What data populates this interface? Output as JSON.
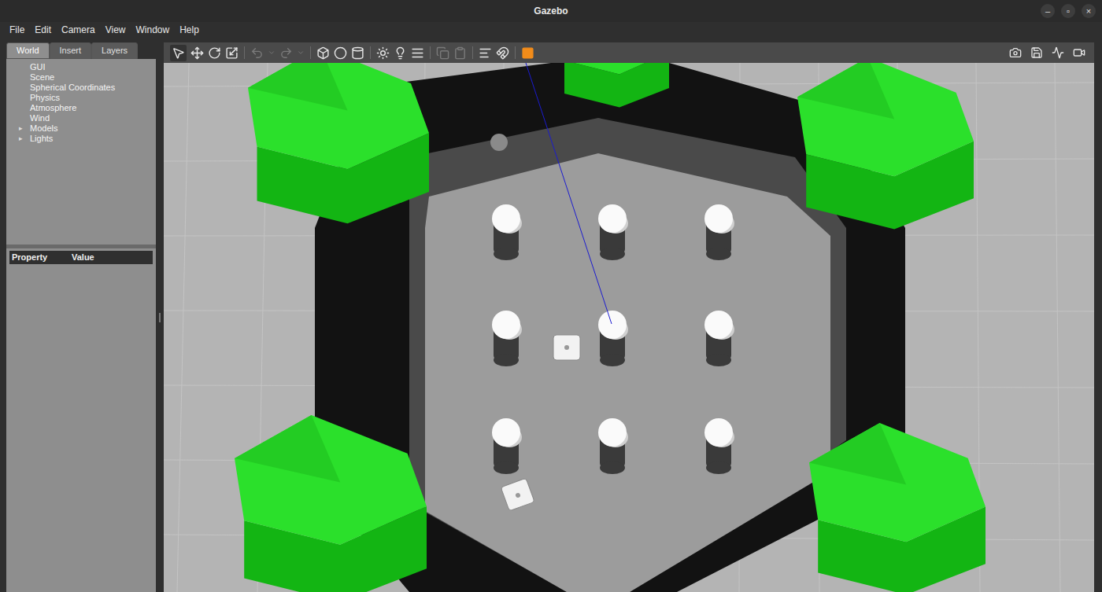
{
  "window": {
    "title": "Gazebo",
    "controls": [
      "–",
      "▫",
      "×"
    ]
  },
  "menu": [
    "File",
    "Edit",
    "Camera",
    "View",
    "Window",
    "Help"
  ],
  "tabs": [
    {
      "label": "World",
      "selected": true
    },
    {
      "label": "Insert",
      "selected": false
    },
    {
      "label": "Layers",
      "selected": false
    }
  ],
  "tree": [
    {
      "label": "GUI",
      "toggle": "",
      "expanded": false
    },
    {
      "label": "Scene",
      "toggle": "",
      "expanded": false
    },
    {
      "label": "Spherical Coordinates",
      "toggle": "",
      "expanded": false
    },
    {
      "label": "Physics",
      "toggle": "",
      "expanded": false
    },
    {
      "label": "Atmosphere",
      "toggle": "",
      "expanded": false
    },
    {
      "label": "Wind",
      "toggle": "",
      "expanded": false
    },
    {
      "label": "Models",
      "toggle": "▸",
      "expanded": false
    },
    {
      "label": "Lights",
      "toggle": "▸",
      "expanded": false
    }
  ],
  "properties": {
    "columns": [
      "Property",
      "Value"
    ]
  }
}
